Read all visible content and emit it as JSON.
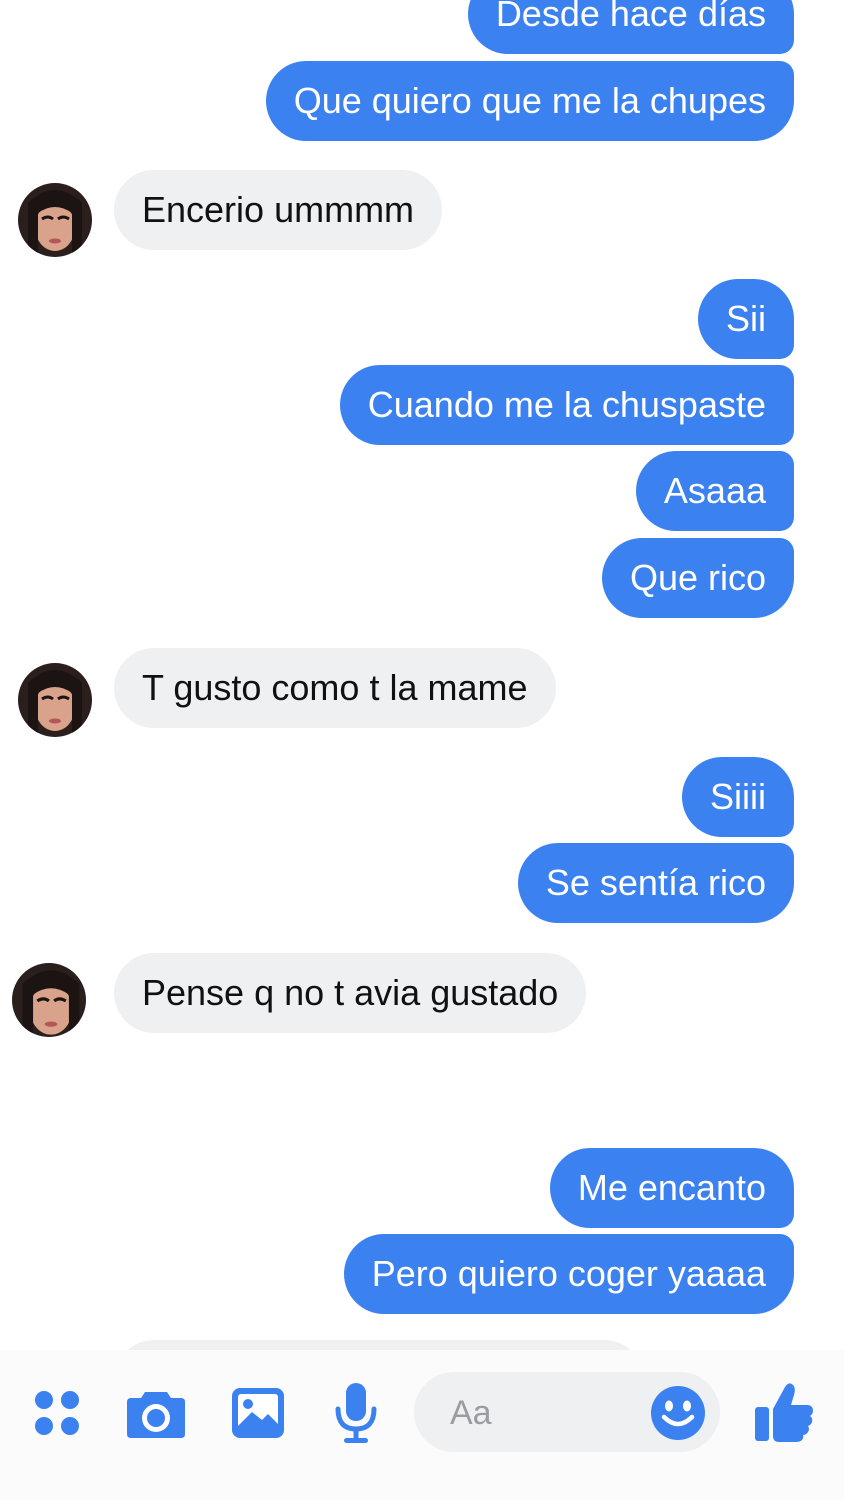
{
  "colors": {
    "accent": "#3b82f0",
    "incoming_bubble": "#eff0f2",
    "background": "#ffffff"
  },
  "messages": [
    {
      "id": "m1",
      "direction": "outgoing",
      "text": "Desde hace días"
    },
    {
      "id": "m2",
      "direction": "outgoing",
      "text": "Que quiero que me la chupes"
    },
    {
      "id": "m3",
      "direction": "incoming",
      "text": "Encerio ummmm"
    },
    {
      "id": "m4",
      "direction": "outgoing",
      "text": "Sii"
    },
    {
      "id": "m5",
      "direction": "outgoing",
      "text": "Cuando me la chuspaste"
    },
    {
      "id": "m6",
      "direction": "outgoing",
      "text": "Asaaa"
    },
    {
      "id": "m7",
      "direction": "outgoing",
      "text": "Que rico"
    },
    {
      "id": "m8",
      "direction": "incoming",
      "text": "T gusto como t la mame"
    },
    {
      "id": "m9",
      "direction": "outgoing",
      "text": "Siiii"
    },
    {
      "id": "m10",
      "direction": "outgoing",
      "text": "Se sentía rico"
    },
    {
      "id": "m11",
      "direction": "incoming",
      "text": "Pense q no t avia gustado"
    },
    {
      "id": "m12",
      "direction": "outgoing",
      "text": "Me encanto"
    },
    {
      "id": "m13",
      "direction": "outgoing",
      "text": "Pero quiero coger yaaaa"
    }
  ],
  "composer": {
    "placeholder": "Aa",
    "icons": [
      "more-apps-icon",
      "camera-icon",
      "gallery-icon",
      "microphone-icon",
      "emoji-icon",
      "thumbs-up-icon"
    ]
  }
}
